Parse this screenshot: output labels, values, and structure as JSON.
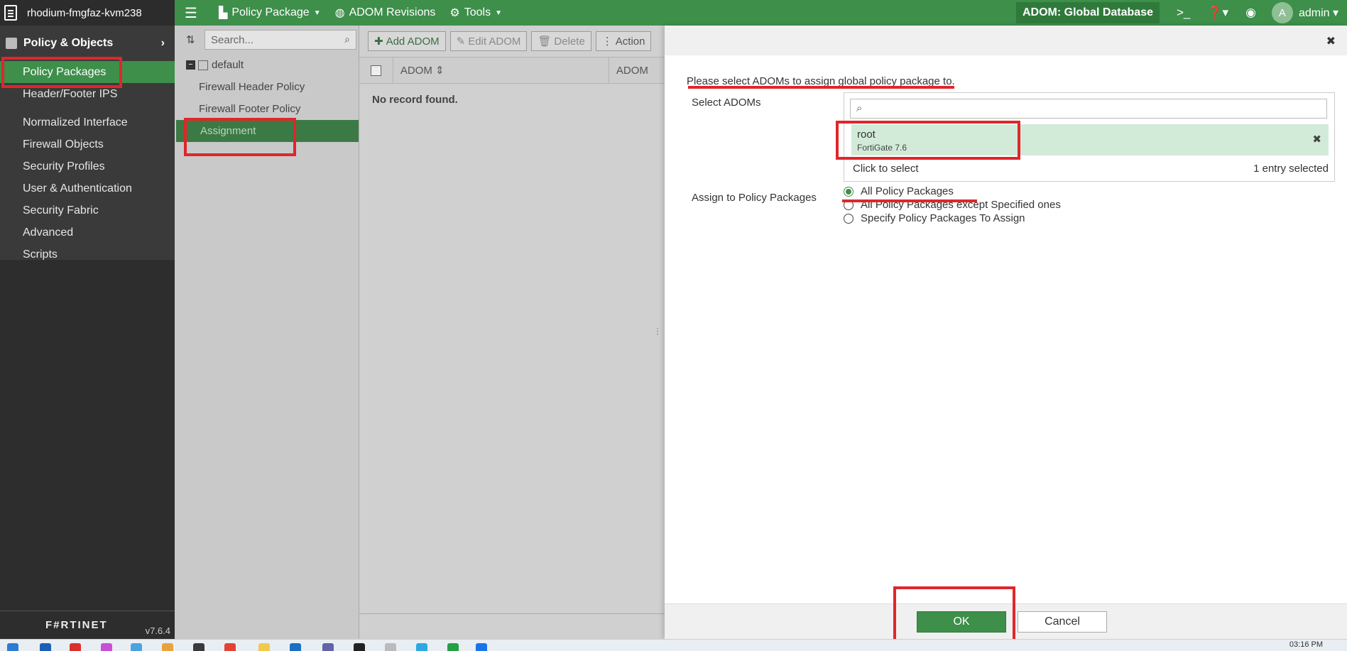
{
  "topbar": {
    "hostname": "rhodium-fmgfaz-kvm238",
    "menu": [
      "Policy Package",
      "ADOM Revisions",
      "Tools"
    ],
    "adom_badge": "ADOM: Global Database",
    "avatar_letter": "A",
    "user": "admin"
  },
  "sidebar": {
    "section": "Policy & Objects",
    "items": [
      "Policy Packages",
      "Header/Footer IPS",
      "Normalized Interface",
      "Firewall Objects",
      "Security Profiles",
      "User & Authentication",
      "Security Fabric",
      "Advanced",
      "Scripts"
    ],
    "logo": "F#RTINET",
    "version": "v7.6.4"
  },
  "tree": {
    "search_placeholder": "Search...",
    "root": "default",
    "children": [
      "Firewall Header Policy",
      "Firewall Footer Policy",
      "Assignment"
    ]
  },
  "list": {
    "buttons": [
      "Add ADOM",
      "Edit ADOM",
      "Delete",
      "Action"
    ],
    "columns": [
      "ADOM",
      "ADOM"
    ],
    "empty_text": "No record found."
  },
  "dialog": {
    "prompt": "Please select ADOMs to assign global policy package to.",
    "select_label": "Select ADOMs",
    "selected_name": "root",
    "selected_sub": "FortiGate 7.6",
    "click_to_select": "Click to select",
    "count": "1 entry selected",
    "assign_label": "Assign to Policy Packages",
    "radios": [
      "All Policy Packages",
      "All Policy Packages except Specified ones",
      "Specify Policy Packages To Assign"
    ],
    "ok": "OK",
    "cancel": "Cancel"
  },
  "taskbar": {
    "clock": "03:16 PM"
  },
  "colors": {
    "brand_green": "#3d8f4a",
    "sidebar_dark": "#3a3a3a",
    "annotation_red": "#e0262b"
  }
}
